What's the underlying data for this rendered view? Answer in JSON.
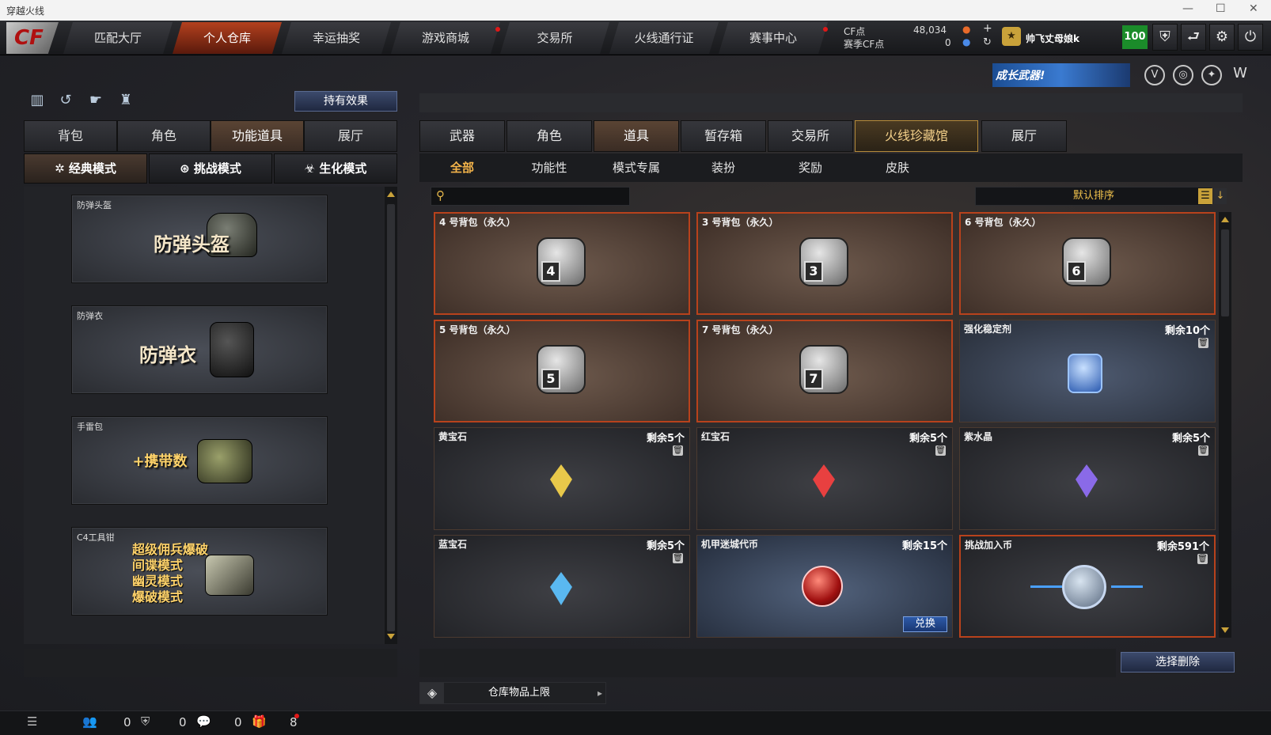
{
  "window": {
    "title": "穿越火线"
  },
  "topnav": {
    "logo": "CF",
    "tabs": [
      {
        "label": "匹配大厅"
      },
      {
        "label": "个人仓库"
      },
      {
        "label": "幸运抽奖"
      },
      {
        "label": "游戏商城"
      },
      {
        "label": "交易所"
      },
      {
        "label": "火线通行证"
      },
      {
        "label": "赛事中心"
      }
    ],
    "cf_label": "CF点",
    "cf_value": "48,034",
    "season_label": "赛季CF点",
    "season_value": "0",
    "username": "帅飞丈母娘k",
    "level": "100"
  },
  "banner": {
    "text": "成长武器!"
  },
  "left": {
    "hold_effect": "持有效果",
    "tabs": [
      "背包",
      "角色",
      "功能道具",
      "展厅"
    ],
    "modes": [
      "经典模式",
      "挑战模式",
      "生化模式"
    ],
    "cards": [
      {
        "title": "防弹头盔",
        "big": "防弹头盔"
      },
      {
        "title": "防弹衣",
        "big": "防弹衣"
      },
      {
        "title": "手雷包",
        "big": "+携带数"
      },
      {
        "title": "C4工具钳",
        "lines": [
          "超级佣兵爆破",
          "间谍模式",
          "幽灵模式",
          "爆破模式"
        ]
      }
    ]
  },
  "right": {
    "tabs": [
      "武器",
      "角色",
      "道具",
      "暂存箱",
      "交易所",
      "火线珍藏馆",
      "展厅"
    ],
    "subtabs": [
      "全部",
      "功能性",
      "模式专属",
      "装扮",
      "奖励",
      "皮肤"
    ],
    "search_placeholder": "",
    "sort": "默认排序",
    "items": [
      {
        "name": "4 号背包（永久）",
        "bag": "4"
      },
      {
        "name": "3 号背包（永久）",
        "bag": "3"
      },
      {
        "name": "6 号背包（永久）",
        "bag": "6"
      },
      {
        "name": "5 号背包（永久）",
        "bag": "5"
      },
      {
        "name": "7 号背包（永久）",
        "bag": "7"
      },
      {
        "name": "强化稳定剂",
        "qty": "剩余10个"
      },
      {
        "name": "黄宝石",
        "qty": "剩余5个",
        "color": "#e8c84a"
      },
      {
        "name": "红宝石",
        "qty": "剩余5个",
        "color": "#e84040"
      },
      {
        "name": "紫水晶",
        "qty": "剩余5个",
        "color": "#8a6ae8"
      },
      {
        "name": "蓝宝石",
        "qty": "剩余5个",
        "color": "#5ab8f0"
      },
      {
        "name": "机甲迷城代币",
        "qty": "剩余15个",
        "action": "兑换"
      },
      {
        "name": "挑战加入币",
        "qty": "剩余591个"
      }
    ],
    "delete_button": "选择删除",
    "capacity_label": "仓库物品上限"
  },
  "bottom": {
    "counts": [
      "0",
      "0",
      "0",
      "8"
    ]
  }
}
